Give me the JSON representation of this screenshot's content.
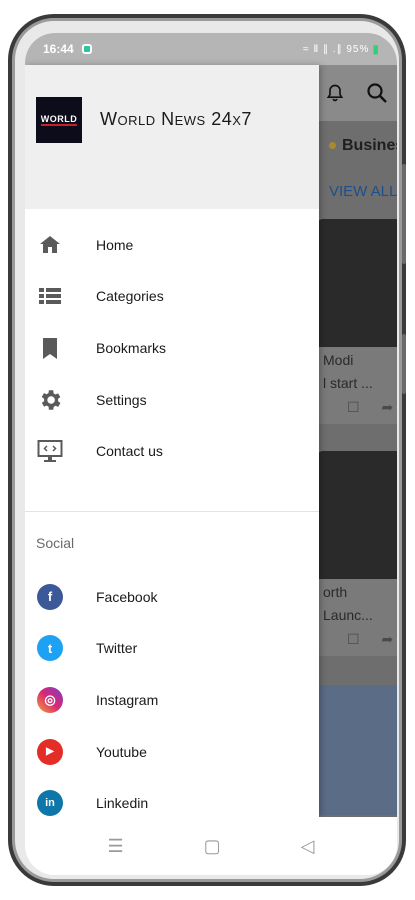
{
  "status_bar": {
    "time": "16:44",
    "indicators": "≈ Ⅱ ∥ .∥ 95%",
    "battery_icon": "battery-icon"
  },
  "background_app": {
    "category_tab": "Busines",
    "view_all": "VIEW ALL",
    "cards": [
      {
        "line1": "Modi",
        "line2": "l start ..."
      },
      {
        "line1": "orth",
        "line2": "Launc..."
      }
    ]
  },
  "drawer": {
    "logo_text": "WORLD",
    "title": "World News 24x7",
    "menu": [
      {
        "label": "Home",
        "icon": "home-icon"
      },
      {
        "label": "Categories",
        "icon": "list-icon"
      },
      {
        "label": "Bookmarks",
        "icon": "bookmark-icon"
      },
      {
        "label": "Settings",
        "icon": "gear-icon"
      },
      {
        "label": "Contact us",
        "icon": "monitor-code-icon"
      }
    ],
    "social_label": "Social",
    "social": [
      {
        "label": "Facebook",
        "icon": "facebook-icon",
        "color": "#3b5998",
        "glyph": "f"
      },
      {
        "label": "Twitter",
        "icon": "twitter-icon",
        "color": "#1da1f2",
        "glyph": "t"
      },
      {
        "label": "Instagram",
        "icon": "instagram-icon",
        "color": "#d62976",
        "glyph": "◎"
      },
      {
        "label": "Youtube",
        "icon": "youtube-icon",
        "color": "#e52d27",
        "glyph": "▶"
      },
      {
        "label": "Linkedin",
        "icon": "linkedin-icon",
        "color": "#0e76a8",
        "glyph": "in"
      }
    ]
  },
  "nav_bar": {
    "recents": "☰",
    "home": "▢",
    "back": "◁"
  },
  "colors": {
    "drawer_header_bg": "#efefef",
    "scrim": "#6e6e6e",
    "view_all": "#1e4e8c"
  }
}
